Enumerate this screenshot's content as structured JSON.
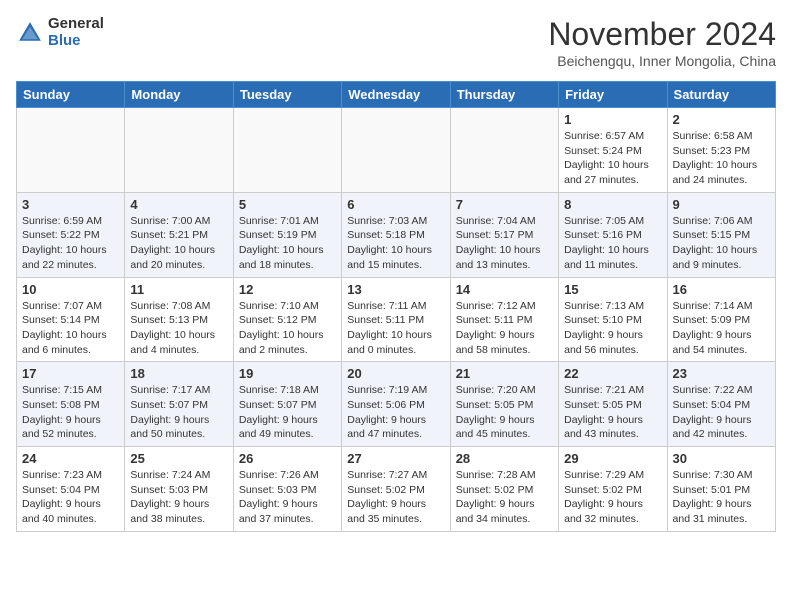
{
  "header": {
    "logo_general": "General",
    "logo_blue": "Blue",
    "month_title": "November 2024",
    "subtitle": "Beichengqu, Inner Mongolia, China"
  },
  "weekdays": [
    "Sunday",
    "Monday",
    "Tuesday",
    "Wednesday",
    "Thursday",
    "Friday",
    "Saturday"
  ],
  "weeks": [
    {
      "alt": false,
      "days": [
        {
          "num": "",
          "info": ""
        },
        {
          "num": "",
          "info": ""
        },
        {
          "num": "",
          "info": ""
        },
        {
          "num": "",
          "info": ""
        },
        {
          "num": "",
          "info": ""
        },
        {
          "num": "1",
          "info": "Sunrise: 6:57 AM\nSunset: 5:24 PM\nDaylight: 10 hours\nand 27 minutes."
        },
        {
          "num": "2",
          "info": "Sunrise: 6:58 AM\nSunset: 5:23 PM\nDaylight: 10 hours\nand 24 minutes."
        }
      ]
    },
    {
      "alt": true,
      "days": [
        {
          "num": "3",
          "info": "Sunrise: 6:59 AM\nSunset: 5:22 PM\nDaylight: 10 hours\nand 22 minutes."
        },
        {
          "num": "4",
          "info": "Sunrise: 7:00 AM\nSunset: 5:21 PM\nDaylight: 10 hours\nand 20 minutes."
        },
        {
          "num": "5",
          "info": "Sunrise: 7:01 AM\nSunset: 5:19 PM\nDaylight: 10 hours\nand 18 minutes."
        },
        {
          "num": "6",
          "info": "Sunrise: 7:03 AM\nSunset: 5:18 PM\nDaylight: 10 hours\nand 15 minutes."
        },
        {
          "num": "7",
          "info": "Sunrise: 7:04 AM\nSunset: 5:17 PM\nDaylight: 10 hours\nand 13 minutes."
        },
        {
          "num": "8",
          "info": "Sunrise: 7:05 AM\nSunset: 5:16 PM\nDaylight: 10 hours\nand 11 minutes."
        },
        {
          "num": "9",
          "info": "Sunrise: 7:06 AM\nSunset: 5:15 PM\nDaylight: 10 hours\nand 9 minutes."
        }
      ]
    },
    {
      "alt": false,
      "days": [
        {
          "num": "10",
          "info": "Sunrise: 7:07 AM\nSunset: 5:14 PM\nDaylight: 10 hours\nand 6 minutes."
        },
        {
          "num": "11",
          "info": "Sunrise: 7:08 AM\nSunset: 5:13 PM\nDaylight: 10 hours\nand 4 minutes."
        },
        {
          "num": "12",
          "info": "Sunrise: 7:10 AM\nSunset: 5:12 PM\nDaylight: 10 hours\nand 2 minutes."
        },
        {
          "num": "13",
          "info": "Sunrise: 7:11 AM\nSunset: 5:11 PM\nDaylight: 10 hours\nand 0 minutes."
        },
        {
          "num": "14",
          "info": "Sunrise: 7:12 AM\nSunset: 5:11 PM\nDaylight: 9 hours\nand 58 minutes."
        },
        {
          "num": "15",
          "info": "Sunrise: 7:13 AM\nSunset: 5:10 PM\nDaylight: 9 hours\nand 56 minutes."
        },
        {
          "num": "16",
          "info": "Sunrise: 7:14 AM\nSunset: 5:09 PM\nDaylight: 9 hours\nand 54 minutes."
        }
      ]
    },
    {
      "alt": true,
      "days": [
        {
          "num": "17",
          "info": "Sunrise: 7:15 AM\nSunset: 5:08 PM\nDaylight: 9 hours\nand 52 minutes."
        },
        {
          "num": "18",
          "info": "Sunrise: 7:17 AM\nSunset: 5:07 PM\nDaylight: 9 hours\nand 50 minutes."
        },
        {
          "num": "19",
          "info": "Sunrise: 7:18 AM\nSunset: 5:07 PM\nDaylight: 9 hours\nand 49 minutes."
        },
        {
          "num": "20",
          "info": "Sunrise: 7:19 AM\nSunset: 5:06 PM\nDaylight: 9 hours\nand 47 minutes."
        },
        {
          "num": "21",
          "info": "Sunrise: 7:20 AM\nSunset: 5:05 PM\nDaylight: 9 hours\nand 45 minutes."
        },
        {
          "num": "22",
          "info": "Sunrise: 7:21 AM\nSunset: 5:05 PM\nDaylight: 9 hours\nand 43 minutes."
        },
        {
          "num": "23",
          "info": "Sunrise: 7:22 AM\nSunset: 5:04 PM\nDaylight: 9 hours\nand 42 minutes."
        }
      ]
    },
    {
      "alt": false,
      "days": [
        {
          "num": "24",
          "info": "Sunrise: 7:23 AM\nSunset: 5:04 PM\nDaylight: 9 hours\nand 40 minutes."
        },
        {
          "num": "25",
          "info": "Sunrise: 7:24 AM\nSunset: 5:03 PM\nDaylight: 9 hours\nand 38 minutes."
        },
        {
          "num": "26",
          "info": "Sunrise: 7:26 AM\nSunset: 5:03 PM\nDaylight: 9 hours\nand 37 minutes."
        },
        {
          "num": "27",
          "info": "Sunrise: 7:27 AM\nSunset: 5:02 PM\nDaylight: 9 hours\nand 35 minutes."
        },
        {
          "num": "28",
          "info": "Sunrise: 7:28 AM\nSunset: 5:02 PM\nDaylight: 9 hours\nand 34 minutes."
        },
        {
          "num": "29",
          "info": "Sunrise: 7:29 AM\nSunset: 5:02 PM\nDaylight: 9 hours\nand 32 minutes."
        },
        {
          "num": "30",
          "info": "Sunrise: 7:30 AM\nSunset: 5:01 PM\nDaylight: 9 hours\nand 31 minutes."
        }
      ]
    }
  ]
}
